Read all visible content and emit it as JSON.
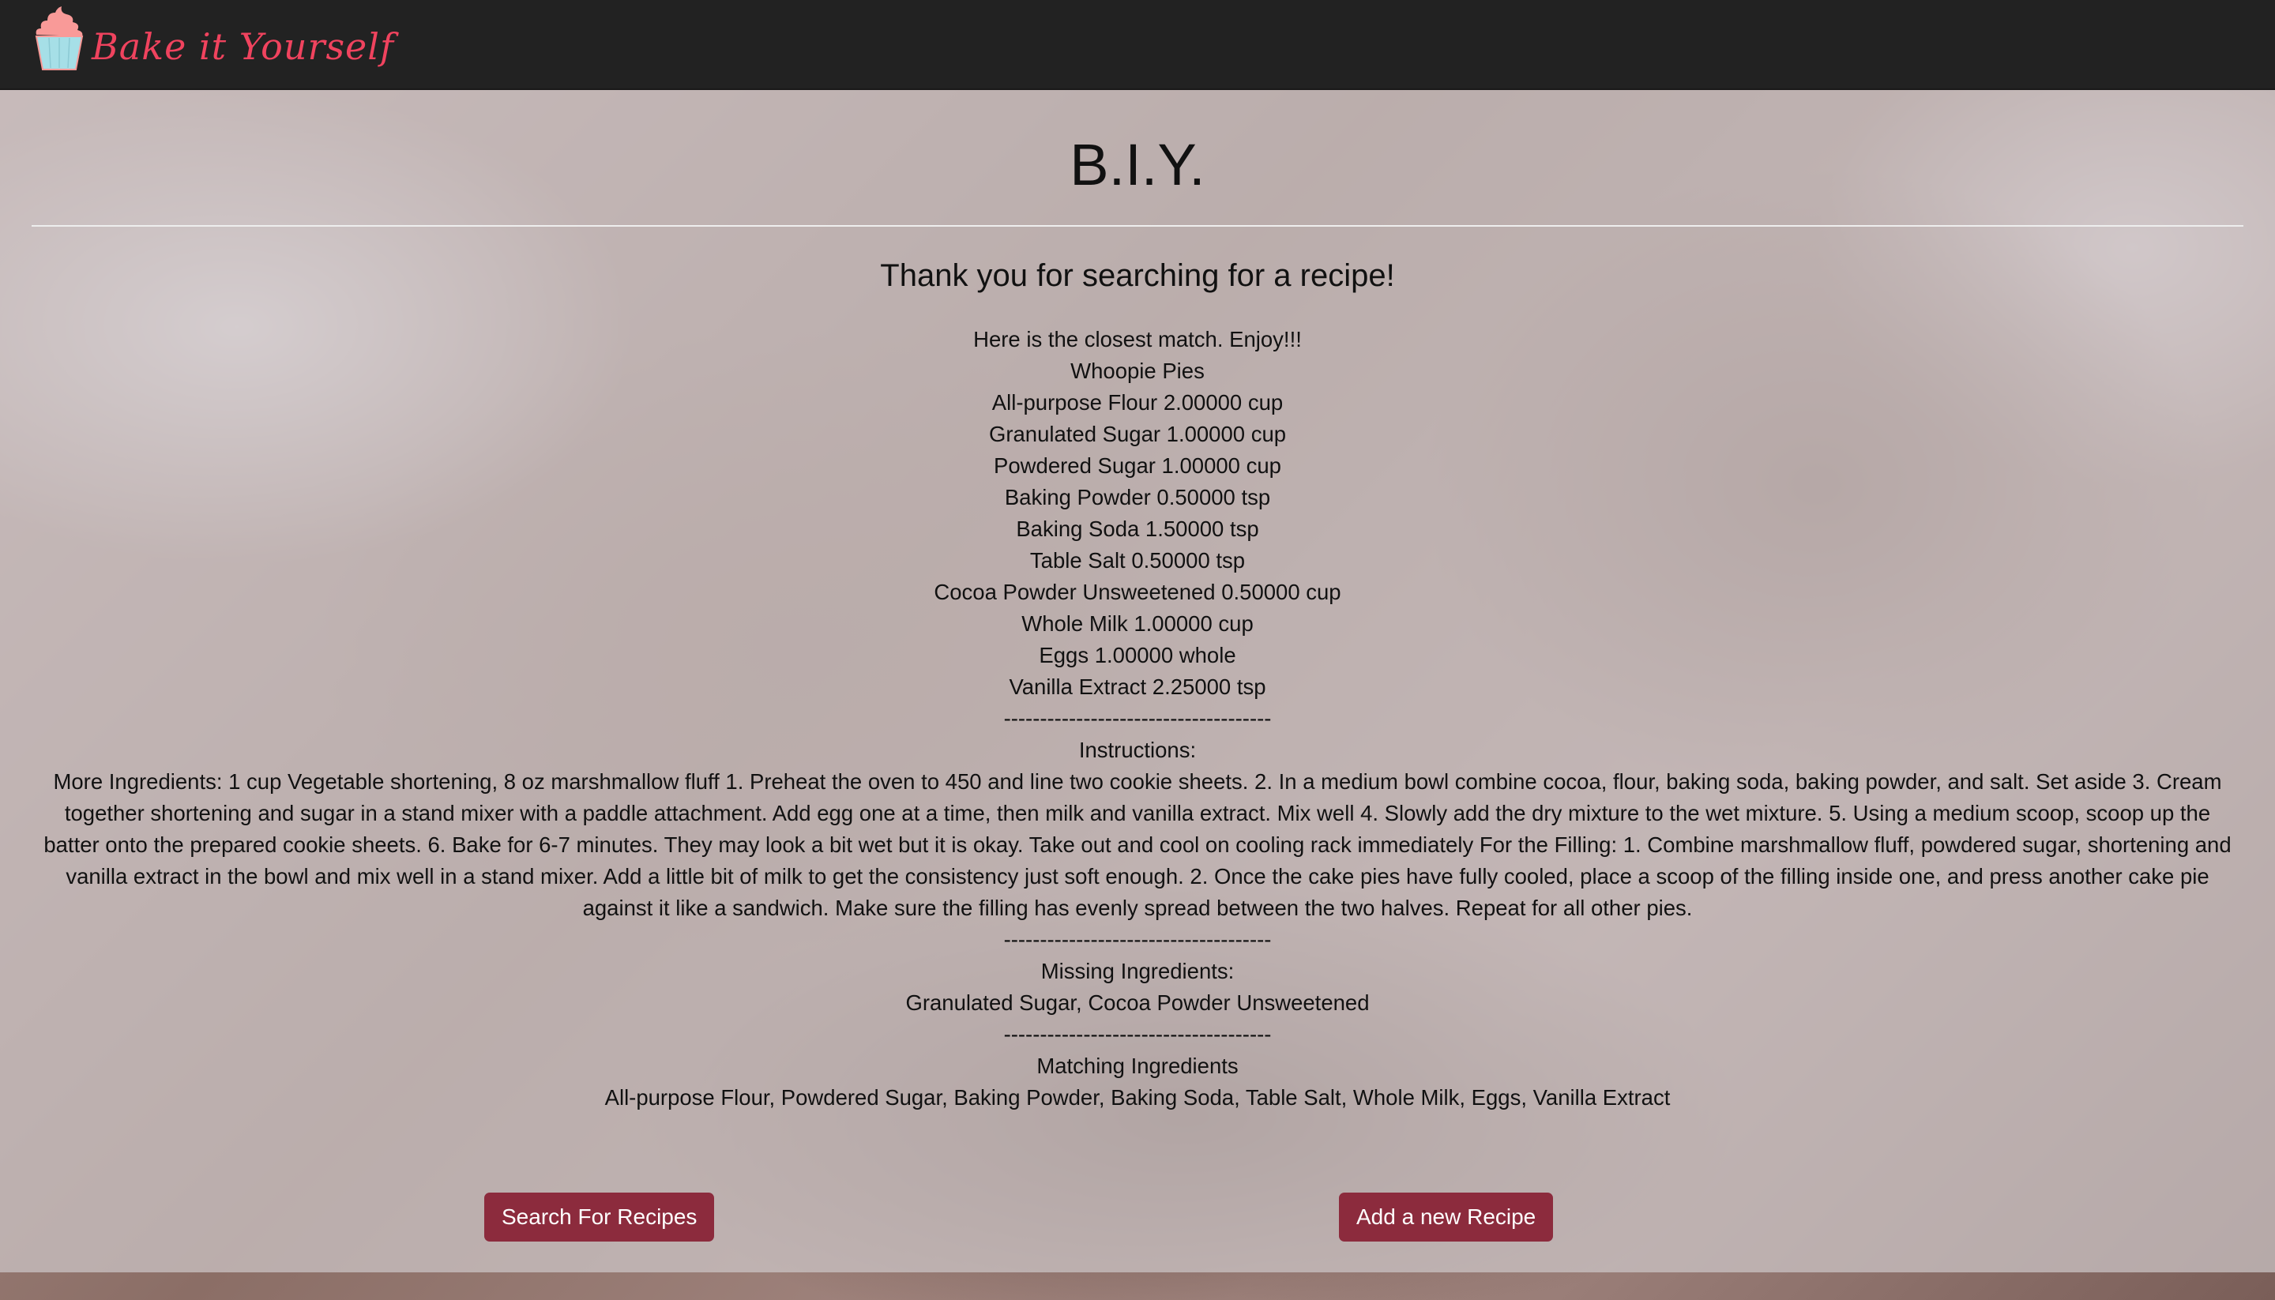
{
  "header": {
    "logo_text": "Bake it Yourself"
  },
  "main": {
    "title": "B.I.Y.",
    "subtitle": "Thank you for searching for a recipe!",
    "intro": "Here is the closest match. Enjoy!!!",
    "recipe_name": "Whoopie Pies",
    "ingredients": [
      "All-purpose Flour 2.00000 cup",
      "Granulated Sugar 1.00000 cup",
      "Powdered Sugar 1.00000 cup",
      "Baking Powder 0.50000 tsp",
      "Baking Soda 1.50000 tsp",
      "Table Salt 0.50000 tsp",
      "Cocoa Powder Unsweetened 0.50000 cup",
      "Whole Milk 1.00000 cup",
      "Eggs 1.00000 whole",
      "Vanilla Extract 2.25000 tsp"
    ],
    "separator": "-------------------------------------",
    "instructions_label": "Instructions:",
    "instructions": "More Ingredients: 1 cup Vegetable shortening, 8 oz marshmallow fluff 1. Preheat the oven to 450 and line two cookie sheets. 2. In a medium bowl combine cocoa, flour, baking soda, baking powder, and salt. Set aside 3. Cream together shortening and sugar in a stand mixer with a paddle attachment. Add egg one at a time, then milk and vanilla extract. Mix well 4. Slowly add the dry mixture to the wet mixture. 5. Using a medium scoop, scoop up the batter onto the prepared cookie sheets. 6. Bake for 6-7 minutes. They may look a bit wet but it is okay. Take out and cool on cooling rack immediately For the Filling: 1. Combine marshmallow fluff, powdered sugar, shortening and vanilla extract in the bowl and mix well in a stand mixer. Add a little bit of milk to get the consistency just soft enough. 2. Once the cake pies have fully cooled, place a scoop of the filling inside one, and press another cake pie against it like a sandwich. Make sure the filling has evenly spread between the two halves. Repeat for all other pies.",
    "missing_label": "Missing Ingredients:",
    "missing": "Granulated Sugar, Cocoa Powder Unsweetened",
    "matching_label": "Matching Ingredients",
    "matching": "All-purpose Flour, Powdered Sugar, Baking Powder, Baking Soda, Table Salt, Whole Milk, Eggs, Vanilla Extract"
  },
  "buttons": {
    "search": "Search For Recipes",
    "add": "Add a new Recipe"
  },
  "colors": {
    "header": "#222222",
    "button": "#8c2b3d",
    "logo": "#f0435e"
  }
}
